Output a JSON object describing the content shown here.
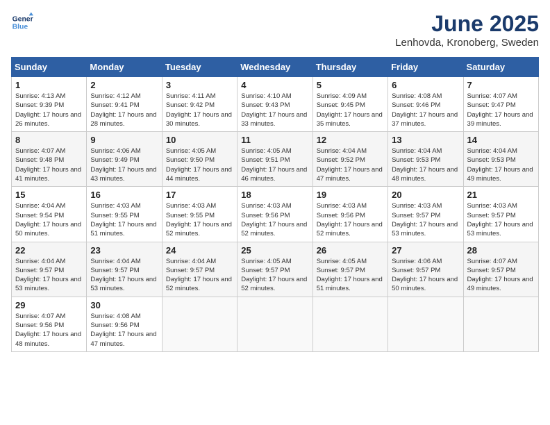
{
  "header": {
    "logo_line1": "General",
    "logo_line2": "Blue",
    "month": "June 2025",
    "location": "Lenhovda, Kronoberg, Sweden"
  },
  "weekdays": [
    "Sunday",
    "Monday",
    "Tuesday",
    "Wednesday",
    "Thursday",
    "Friday",
    "Saturday"
  ],
  "weeks": [
    [
      {
        "day": "1",
        "sunrise": "Sunrise: 4:13 AM",
        "sunset": "Sunset: 9:39 PM",
        "daylight": "Daylight: 17 hours and 26 minutes."
      },
      {
        "day": "2",
        "sunrise": "Sunrise: 4:12 AM",
        "sunset": "Sunset: 9:41 PM",
        "daylight": "Daylight: 17 hours and 28 minutes."
      },
      {
        "day": "3",
        "sunrise": "Sunrise: 4:11 AM",
        "sunset": "Sunset: 9:42 PM",
        "daylight": "Daylight: 17 hours and 30 minutes."
      },
      {
        "day": "4",
        "sunrise": "Sunrise: 4:10 AM",
        "sunset": "Sunset: 9:43 PM",
        "daylight": "Daylight: 17 hours and 33 minutes."
      },
      {
        "day": "5",
        "sunrise": "Sunrise: 4:09 AM",
        "sunset": "Sunset: 9:45 PM",
        "daylight": "Daylight: 17 hours and 35 minutes."
      },
      {
        "day": "6",
        "sunrise": "Sunrise: 4:08 AM",
        "sunset": "Sunset: 9:46 PM",
        "daylight": "Daylight: 17 hours and 37 minutes."
      },
      {
        "day": "7",
        "sunrise": "Sunrise: 4:07 AM",
        "sunset": "Sunset: 9:47 PM",
        "daylight": "Daylight: 17 hours and 39 minutes."
      }
    ],
    [
      {
        "day": "8",
        "sunrise": "Sunrise: 4:07 AM",
        "sunset": "Sunset: 9:48 PM",
        "daylight": "Daylight: 17 hours and 41 minutes."
      },
      {
        "day": "9",
        "sunrise": "Sunrise: 4:06 AM",
        "sunset": "Sunset: 9:49 PM",
        "daylight": "Daylight: 17 hours and 43 minutes."
      },
      {
        "day": "10",
        "sunrise": "Sunrise: 4:05 AM",
        "sunset": "Sunset: 9:50 PM",
        "daylight": "Daylight: 17 hours and 44 minutes."
      },
      {
        "day": "11",
        "sunrise": "Sunrise: 4:05 AM",
        "sunset": "Sunset: 9:51 PM",
        "daylight": "Daylight: 17 hours and 46 minutes."
      },
      {
        "day": "12",
        "sunrise": "Sunrise: 4:04 AM",
        "sunset": "Sunset: 9:52 PM",
        "daylight": "Daylight: 17 hours and 47 minutes."
      },
      {
        "day": "13",
        "sunrise": "Sunrise: 4:04 AM",
        "sunset": "Sunset: 9:53 PM",
        "daylight": "Daylight: 17 hours and 48 minutes."
      },
      {
        "day": "14",
        "sunrise": "Sunrise: 4:04 AM",
        "sunset": "Sunset: 9:53 PM",
        "daylight": "Daylight: 17 hours and 49 minutes."
      }
    ],
    [
      {
        "day": "15",
        "sunrise": "Sunrise: 4:04 AM",
        "sunset": "Sunset: 9:54 PM",
        "daylight": "Daylight: 17 hours and 50 minutes."
      },
      {
        "day": "16",
        "sunrise": "Sunrise: 4:03 AM",
        "sunset": "Sunset: 9:55 PM",
        "daylight": "Daylight: 17 hours and 51 minutes."
      },
      {
        "day": "17",
        "sunrise": "Sunrise: 4:03 AM",
        "sunset": "Sunset: 9:55 PM",
        "daylight": "Daylight: 17 hours and 52 minutes."
      },
      {
        "day": "18",
        "sunrise": "Sunrise: 4:03 AM",
        "sunset": "Sunset: 9:56 PM",
        "daylight": "Daylight: 17 hours and 52 minutes."
      },
      {
        "day": "19",
        "sunrise": "Sunrise: 4:03 AM",
        "sunset": "Sunset: 9:56 PM",
        "daylight": "Daylight: 17 hours and 52 minutes."
      },
      {
        "day": "20",
        "sunrise": "Sunrise: 4:03 AM",
        "sunset": "Sunset: 9:57 PM",
        "daylight": "Daylight: 17 hours and 53 minutes."
      },
      {
        "day": "21",
        "sunrise": "Sunrise: 4:03 AM",
        "sunset": "Sunset: 9:57 PM",
        "daylight": "Daylight: 17 hours and 53 minutes."
      }
    ],
    [
      {
        "day": "22",
        "sunrise": "Sunrise: 4:04 AM",
        "sunset": "Sunset: 9:57 PM",
        "daylight": "Daylight: 17 hours and 53 minutes."
      },
      {
        "day": "23",
        "sunrise": "Sunrise: 4:04 AM",
        "sunset": "Sunset: 9:57 PM",
        "daylight": "Daylight: 17 hours and 53 minutes."
      },
      {
        "day": "24",
        "sunrise": "Sunrise: 4:04 AM",
        "sunset": "Sunset: 9:57 PM",
        "daylight": "Daylight: 17 hours and 52 minutes."
      },
      {
        "day": "25",
        "sunrise": "Sunrise: 4:05 AM",
        "sunset": "Sunset: 9:57 PM",
        "daylight": "Daylight: 17 hours and 52 minutes."
      },
      {
        "day": "26",
        "sunrise": "Sunrise: 4:05 AM",
        "sunset": "Sunset: 9:57 PM",
        "daylight": "Daylight: 17 hours and 51 minutes."
      },
      {
        "day": "27",
        "sunrise": "Sunrise: 4:06 AM",
        "sunset": "Sunset: 9:57 PM",
        "daylight": "Daylight: 17 hours and 50 minutes."
      },
      {
        "day": "28",
        "sunrise": "Sunrise: 4:07 AM",
        "sunset": "Sunset: 9:57 PM",
        "daylight": "Daylight: 17 hours and 49 minutes."
      }
    ],
    [
      {
        "day": "29",
        "sunrise": "Sunrise: 4:07 AM",
        "sunset": "Sunset: 9:56 PM",
        "daylight": "Daylight: 17 hours and 48 minutes."
      },
      {
        "day": "30",
        "sunrise": "Sunrise: 4:08 AM",
        "sunset": "Sunset: 9:56 PM",
        "daylight": "Daylight: 17 hours and 47 minutes."
      },
      null,
      null,
      null,
      null,
      null
    ]
  ]
}
